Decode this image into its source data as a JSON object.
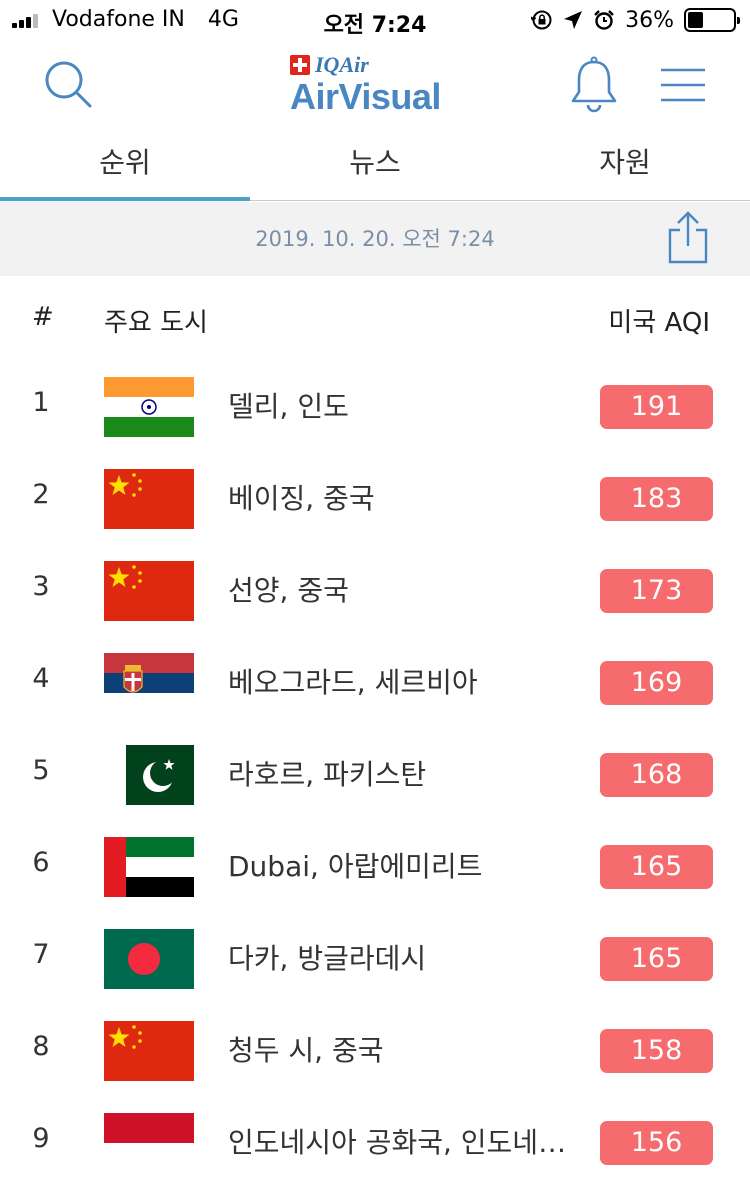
{
  "status_bar": {
    "carrier": "Vodafone IN",
    "network": "4G",
    "time": "오전 7:24",
    "battery": "36%",
    "battery_level": 0.36,
    "icons": [
      "signal-icon",
      "orientation-lock-icon",
      "location-arrow-icon",
      "alarm-icon",
      "battery-icon"
    ]
  },
  "header": {
    "brand_small": "IQAir",
    "brand_large": "AirVisual",
    "icons": [
      "search-icon",
      "bell-icon",
      "hamburger-menu-icon"
    ]
  },
  "tabs": [
    {
      "label": "순위",
      "active": true
    },
    {
      "label": "뉴스",
      "active": false
    },
    {
      "label": "자원",
      "active": false
    }
  ],
  "timestamp": "2019. 10. 20. 오전 7:24",
  "table": {
    "col_rank": "#",
    "col_city": "주요 도시",
    "col_aqi": "미국 AQI",
    "rows": [
      {
        "rank": "1",
        "city": "델리, 인도",
        "aqi": "191",
        "flag": "india-flag-icon"
      },
      {
        "rank": "2",
        "city": "베이징, 중국",
        "aqi": "183",
        "flag": "china-flag-icon"
      },
      {
        "rank": "3",
        "city": "선양, 중국",
        "aqi": "173",
        "flag": "china-flag-icon"
      },
      {
        "rank": "4",
        "city": "베오그라드, 세르비아",
        "aqi": "169",
        "flag": "serbia-flag-icon"
      },
      {
        "rank": "5",
        "city": "라호르, 파키스탄",
        "aqi": "168",
        "flag": "pakistan-flag-icon"
      },
      {
        "rank": "6",
        "city": "Dubai, 아랍에미리트",
        "aqi": "165",
        "flag": "uae-flag-icon"
      },
      {
        "rank": "7",
        "city": "다카, 방글라데시",
        "aqi": "165",
        "flag": "bangladesh-flag-icon"
      },
      {
        "rank": "8",
        "city": "청두 시, 중국",
        "aqi": "158",
        "flag": "china-flag-icon"
      },
      {
        "rank": "9",
        "city": "인도네시아 공화국, 인도네시아",
        "aqi": "156",
        "flag": "indonesia-flag-icon"
      }
    ]
  },
  "colors": {
    "brand_blue": "#4a87c2",
    "tab_indicator": "#4aa3c7",
    "aqi_badge": "#f66b6d",
    "date_bar_bg": "#f2f2f2"
  }
}
